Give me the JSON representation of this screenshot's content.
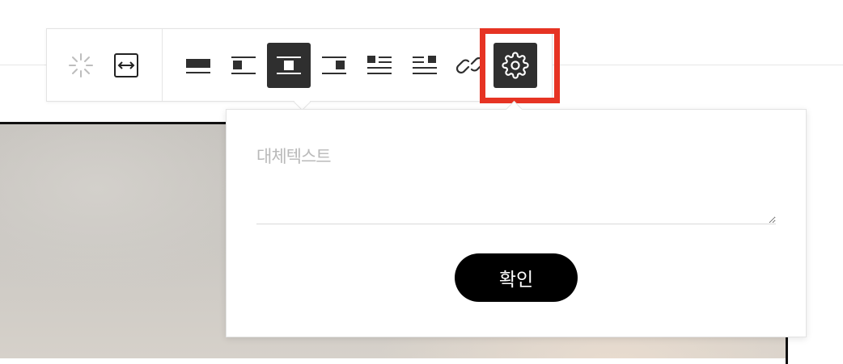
{
  "alt_text": {
    "placeholder": "대체텍스트",
    "value": ""
  },
  "confirm_label": "확인",
  "toolbar": {
    "buttons": [
      {
        "name": "loading-icon",
        "state": "disabled"
      },
      {
        "name": "resize-width-icon"
      },
      {
        "name": "align-full-icon"
      },
      {
        "name": "align-left-icon"
      },
      {
        "name": "align-center-icon",
        "state": "active"
      },
      {
        "name": "align-right-icon"
      },
      {
        "name": "wrap-left-icon"
      },
      {
        "name": "wrap-right-icon"
      },
      {
        "name": "link-icon"
      },
      {
        "name": "settings-icon",
        "state": "active"
      }
    ],
    "highlight_color": "#e63323"
  },
  "colors": {
    "active_button": "#2f2f2f",
    "confirm_button": "#000000",
    "placeholder": "#b9b9b9"
  }
}
